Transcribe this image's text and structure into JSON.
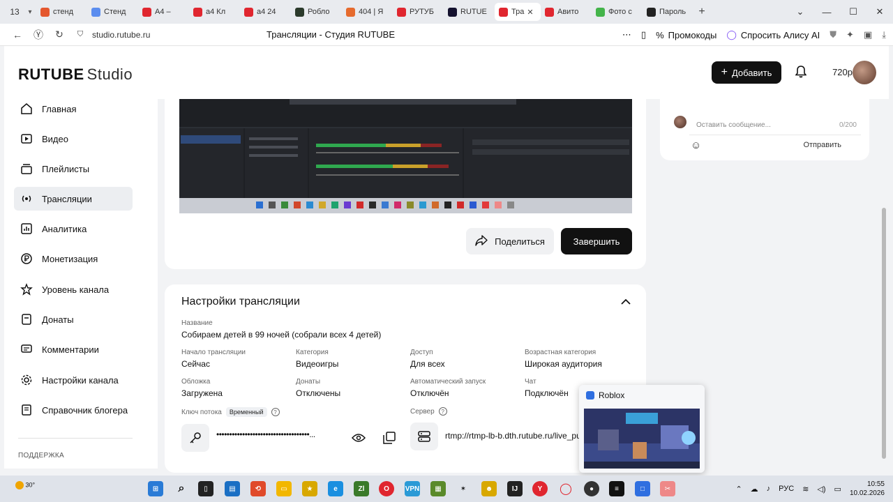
{
  "browser": {
    "tab_counter": "13",
    "tabs": [
      {
        "label": "стенд",
        "color": "#e4572e"
      },
      {
        "label": "Стенд",
        "color": "#5b8def"
      },
      {
        "label": "А4 –",
        "color": "#e0262f"
      },
      {
        "label": "а4 Кл",
        "color": "#e0262f"
      },
      {
        "label": "а4 24",
        "color": "#e0262f"
      },
      {
        "label": "Робло",
        "color": "#2b3a2b"
      },
      {
        "label": "404 | Я",
        "color": "#e66b2e"
      },
      {
        "label": "РУТУБ",
        "color": "#e0262f"
      },
      {
        "label": "RUTUE",
        "color": "#14112e"
      },
      {
        "label": "Тра",
        "color": "#e0262f"
      },
      {
        "label": "Авито",
        "color": "#e0262f"
      },
      {
        "label": "Фото с",
        "color": "#44b44a"
      },
      {
        "label": "Пароль",
        "color": "#222"
      }
    ],
    "url": "studio.rutube.ru",
    "page_title": "Трансляции - Студия RUTUBE",
    "promo_label": "Промокоды",
    "alice_label": "Спросить Алису AI"
  },
  "header": {
    "logo_main": "RUTUBE",
    "logo_studio": "Studio",
    "add_label": "Добавить",
    "balance": "720р"
  },
  "sidebar": {
    "items": [
      {
        "label": "Главная",
        "icon": "home-icon"
      },
      {
        "label": "Видео",
        "icon": "video-icon"
      },
      {
        "label": "Плейлисты",
        "icon": "playlist-icon"
      },
      {
        "label": "Трансляции",
        "icon": "broadcast-icon"
      },
      {
        "label": "Аналитика",
        "icon": "analytics-icon"
      },
      {
        "label": "Монетизация",
        "icon": "ruble-icon"
      },
      {
        "label": "Уровень канала",
        "icon": "star-icon"
      },
      {
        "label": "Донаты",
        "icon": "donation-icon"
      },
      {
        "label": "Комментарии",
        "icon": "comment-icon"
      },
      {
        "label": "Настройки канала",
        "icon": "gear-icon"
      },
      {
        "label": "Справочник блогера",
        "icon": "book-icon"
      }
    ],
    "support_label": "ПОДДЕРЖКА"
  },
  "stream": {
    "share_label": "Поделиться",
    "finish_label": "Завершить"
  },
  "settings": {
    "title": "Настройки трансляции",
    "name_label": "Название",
    "name_value": "Собираем детей в 99 ночей (собрали всех 4 детей)",
    "start_label": "Начало трансляции",
    "start_value": "Сейчас",
    "category_label": "Категория",
    "category_value": "Видеоигры",
    "access_label": "Доступ",
    "access_value": "Для всех",
    "age_label": "Возрастная категория",
    "age_value": "Широкая аудитория",
    "cover_label": "Обложка",
    "cover_value": "Загружена",
    "donations_label": "Донаты",
    "donations_value": "Отключены",
    "autostart_label": "Автоматический запуск",
    "autostart_value": "Отключён",
    "chat_label": "Чат",
    "chat_value": "Подключён",
    "key_label": "Ключ потока",
    "key_badge": "Временный",
    "key_masked": "••••••••••••••••••••••••••••••••••••...",
    "server_label": "Сервер",
    "server_value": "rtmp://rtmp-lb-b.dth.rutube.ru/live_pu"
  },
  "chat": {
    "placeholder": "Оставить сообщение...",
    "counter": "0/200",
    "send_label": "Отправить"
  },
  "popup": {
    "title": "Roblox"
  },
  "taskbar": {
    "weather": "30°",
    "lang": "РУС",
    "time": "10:55",
    "date": "10.02.2026"
  }
}
